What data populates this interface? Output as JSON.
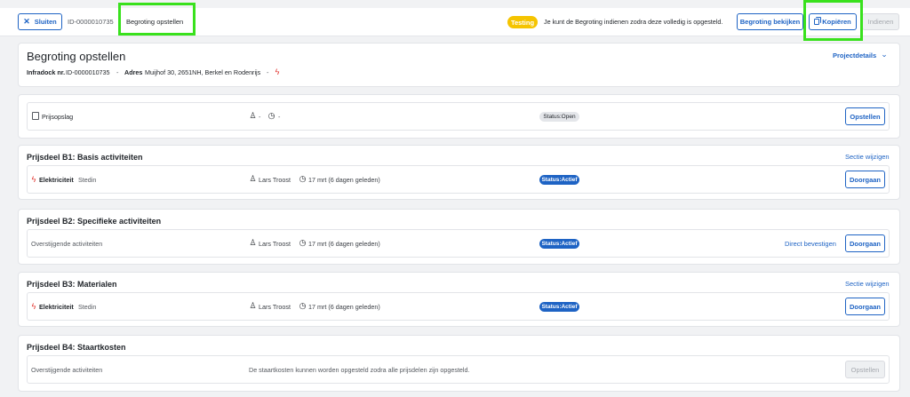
{
  "topbar": {
    "close_label": "Sluiten",
    "id": "ID-0000010735",
    "active_title": "Begroting opstellen",
    "testing_badge": "Testing",
    "notice": "Je kunt de Begroting indienen zodra deze volledig is opgesteld.",
    "view_label": "Begroting bekijken",
    "copy_label": "Kopiëren",
    "submit_label": "Indienen"
  },
  "header": {
    "title": "Begroting opstellen",
    "infradock_label": "Infradock nr.",
    "infradock_value": "ID-0000010735",
    "address_label": "Adres",
    "address_value": "Muijhof 30, 2651NH, Berkel en Rodenrijs",
    "project_details": "Projectdetails"
  },
  "price_quote": {
    "label": "Prijsopslag",
    "user": "-",
    "time": "-",
    "status": "Status:Open",
    "button": "Opstellen"
  },
  "sections": [
    {
      "title": "Prijsdeel B1: Basis activiteiten",
      "edit_link": "Sectie wijzigen",
      "row": {
        "type": "Elektriciteit",
        "company": "Stedin",
        "user": "Lars Troost",
        "time": "17 mrt (6 dagen geleden)",
        "status": "Status:Actief",
        "button": "Doorgaan"
      }
    },
    {
      "title": "Prijsdeel B2: Specifieke activiteiten",
      "row": {
        "label": "Overstijgende activiteiten",
        "user": "Lars Troost",
        "time": "17 mrt (6 dagen geleden)",
        "status": "Status:Actief",
        "confirm_link": "Direct bevestigen",
        "button": "Doorgaan"
      }
    },
    {
      "title": "Prijsdeel B3: Materialen",
      "edit_link": "Sectie wijzigen",
      "row": {
        "type": "Elektriciteit",
        "company": "Stedin",
        "user": "Lars Troost",
        "time": "17 mrt (6 dagen geleden)",
        "status": "Status:Actief",
        "button": "Doorgaan"
      }
    },
    {
      "title": "Prijsdeel B4: Staartkosten",
      "row": {
        "label": "Overstijgende activiteiten",
        "message": "De staartkosten kunnen worden opgesteld zodra alle prijsdelen zijn opgesteld.",
        "button": "Opstellen"
      }
    }
  ],
  "colors": {
    "accent": "#1e63c4",
    "highlight": "#39e11d",
    "testing": "#f5c400",
    "electric": "#e0312b"
  }
}
